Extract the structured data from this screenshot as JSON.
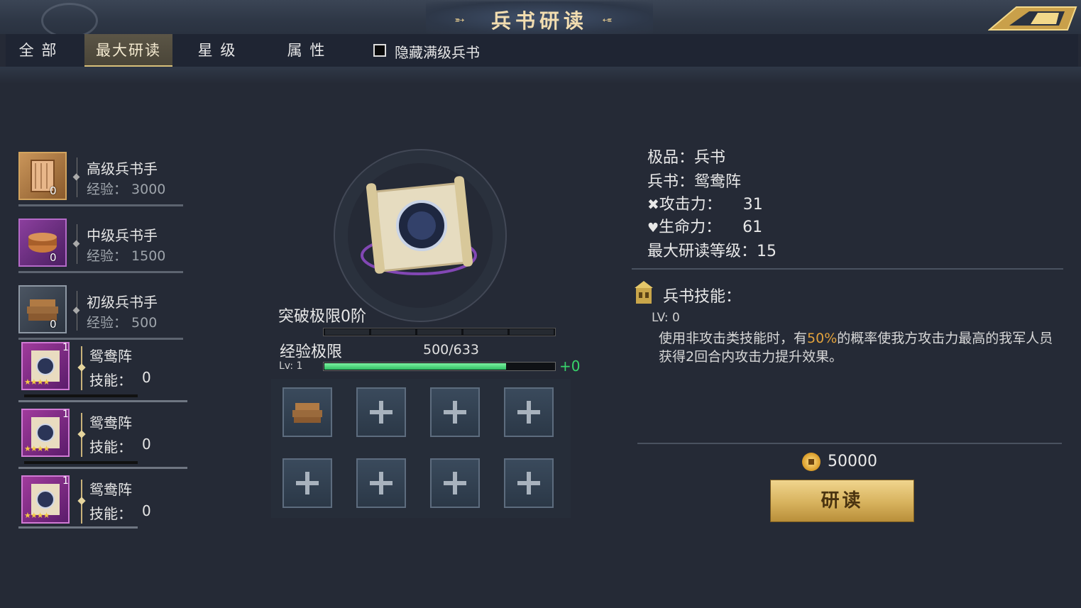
{
  "header": {
    "title": "兵书研读",
    "back_icon": "back-arrow-icon"
  },
  "tabs": [
    {
      "label": "全 部",
      "active": false
    },
    {
      "label": "最大研读",
      "active": true
    },
    {
      "label": "星 级",
      "active": false
    },
    {
      "label": "属 性",
      "active": false
    }
  ],
  "filter": {
    "label": "隐藏满级兵书",
    "checked": false
  },
  "materials": [
    {
      "name": "高级兵书手",
      "exp_label": "经验：",
      "exp": "3000",
      "count": "0",
      "icon": "advanced-book-icon"
    },
    {
      "name": "中级兵书手",
      "exp_label": "经验：",
      "exp": "1500",
      "count": "0",
      "icon": "intermediate-book-icon"
    },
    {
      "name": "初级兵书手",
      "exp_label": "经验：",
      "exp": "500",
      "count": "0",
      "icon": "basic-book-icon"
    }
  ],
  "books": [
    {
      "name": "鸳鸯阵",
      "skill_label": "技能：",
      "skill": "0",
      "level": "1",
      "stars": "★★★★"
    },
    {
      "name": "鸳鸯阵",
      "skill_label": "技能：",
      "skill": "0",
      "level": "1",
      "stars": "★★★★"
    },
    {
      "name": "鸳鸯阵",
      "skill_label": "技能：",
      "skill": "0",
      "level": "1",
      "stars": "★★★★"
    }
  ],
  "center": {
    "break_label": "突破极限0阶",
    "break_segments_filled": 0,
    "exp_label": "经验极限",
    "exp_count": "500/633",
    "exp_fraction": 0.79,
    "lv_label": "Lv: 1",
    "exp_plus": "+0"
  },
  "info": {
    "quality": "极品：兵书",
    "book": "兵书：鸳鸯阵",
    "attack_label": "攻击力：",
    "attack": "31",
    "hp_label": "生命力：",
    "hp": "61",
    "max_level": "最大研读等级：15",
    "skill_title": "兵书技能：",
    "skill_lv": "LV: 0",
    "skill_desc_1": "使用非攻击类技能时，有",
    "skill_desc_hl": "50%",
    "skill_desc_2": "的概率使我方攻击力最高的我军人员获得2回合内攻击力提升效果。"
  },
  "cost": {
    "value": "50000",
    "button": "研读"
  },
  "colors": {
    "accent_gold": "#d9c07a",
    "exp_green": "#38d46b",
    "highlight": "#e3a23c"
  }
}
